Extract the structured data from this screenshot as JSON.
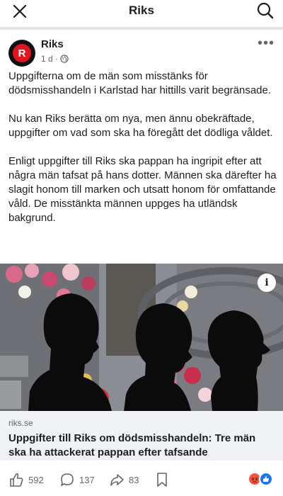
{
  "topbar": {
    "title": "Riks",
    "close_icon": "close-icon",
    "search_icon": "search-icon"
  },
  "post": {
    "author": "Riks",
    "avatar_letter": "R",
    "time": "1 d",
    "dot": "·",
    "audience_icon": "globe-icon",
    "more_icon": "more-options-icon",
    "more": "•••",
    "paragraphs": [
      "Uppgifterna om de män som misstänks för dödsmisshandeln i Karlstad har hittills varit begränsade.",
      "Nu kan Riks berätta om nya, men ännu obekräftade, uppgifter om vad som ska ha föregått det dödliga våldet.",
      "Enligt uppgifter till Riks ska pappan ha ingripit efter att några män tafsat på hans dotter. Männen ska därefter ha slagit honom till marken och utsatt honom för omfattande våld. De misstänkta männen uppges ha utländsk bakgrund."
    ],
    "info_glyph": "i"
  },
  "link": {
    "domain": "riks.se",
    "title": "Uppgifter till Riks om dödsmisshandeln: Tre män ska ha attackerat pappan efter tafsande"
  },
  "actions": {
    "likes": "592",
    "comments": "137",
    "shares": "83"
  },
  "colors": {
    "brand_red": "#e1141f",
    "like_blue": "#1877f2",
    "angry_orange": "#f5533d"
  }
}
